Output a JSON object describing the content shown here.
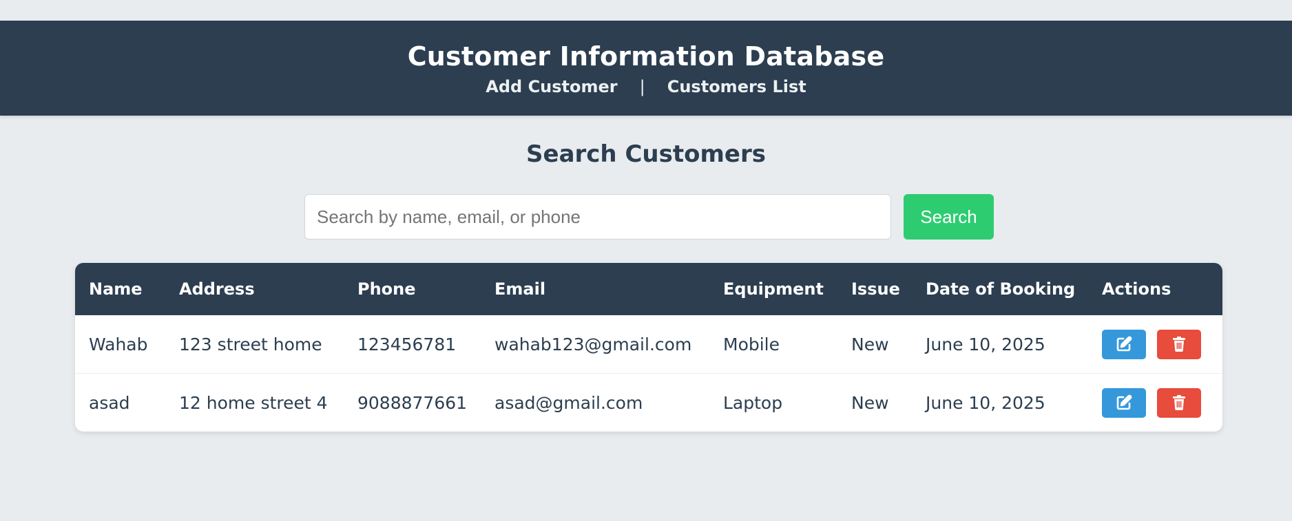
{
  "header": {
    "title": "Customer Information Database",
    "nav": {
      "add_customer": "Add Customer",
      "separator": "|",
      "customers_list": "Customers List"
    }
  },
  "search": {
    "title": "Search Customers",
    "placeholder": "Search by name, email, or phone",
    "value": "",
    "button_label": "Search"
  },
  "table": {
    "headers": {
      "name": "Name",
      "address": "Address",
      "phone": "Phone",
      "email": "Email",
      "equipment": "Equipment",
      "issue": "Issue",
      "date": "Date of Booking",
      "actions": "Actions"
    },
    "rows": [
      {
        "name": "Wahab",
        "address": "123 street home",
        "phone": "123456781",
        "email": "wahab123@gmail.com",
        "equipment": "Mobile",
        "issue": "New",
        "date": "June 10, 2025"
      },
      {
        "name": "asad",
        "address": "12 home street 4",
        "phone": "9088877661",
        "email": "asad@gmail.com",
        "equipment": "Laptop",
        "issue": "New",
        "date": "June 10, 2025"
      }
    ]
  },
  "icons": {
    "edit": "edit-icon",
    "delete": "trash-icon"
  },
  "colors": {
    "header_bg": "#2c3e50",
    "page_bg": "#e8ecef",
    "search_button": "#2ecc71",
    "edit_button": "#3498db",
    "delete_button": "#e74c3c"
  }
}
